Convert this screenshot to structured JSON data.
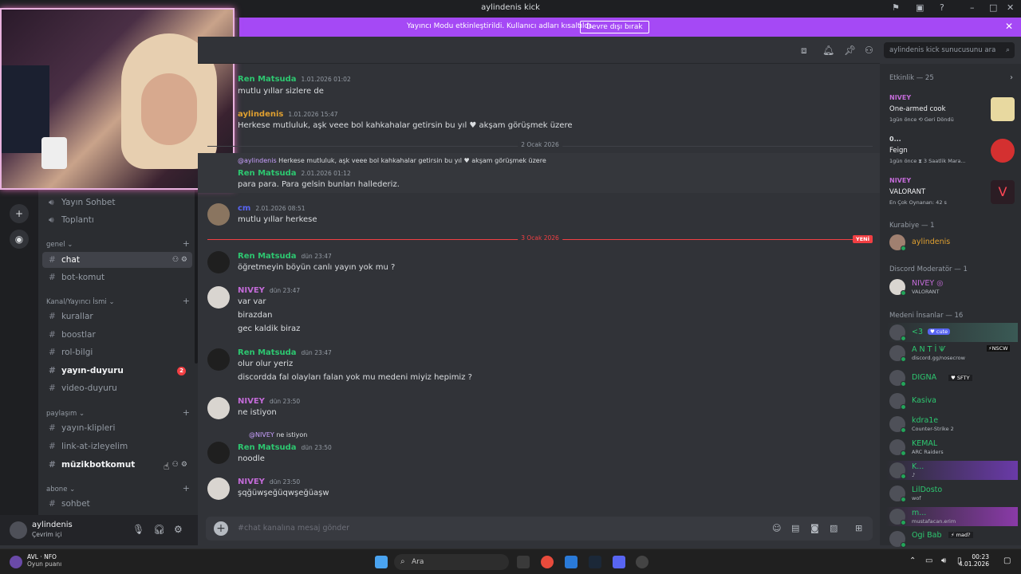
{
  "window": {
    "title": "aylindenis kick"
  },
  "banner": {
    "message": "Yayıncı Modu etkinleştirildi. Kullanıcı adları kısaltıldı.",
    "button": "Devre dışı bırak"
  },
  "channels": {
    "top": [
      {
        "name": "Yayın Sohbet",
        "icon": "speaker-icon"
      },
      {
        "name": "Toplantı",
        "icon": "speaker-icon"
      }
    ],
    "categories": [
      {
        "label": "genel",
        "items": [
          {
            "name": "chat",
            "active": true
          },
          {
            "name": "bot-komut"
          }
        ]
      },
      {
        "label": "Kanal/Yayıncı İsmi",
        "items": [
          {
            "name": "kurallar"
          },
          {
            "name": "boostlar"
          },
          {
            "name": "rol-bilgi"
          },
          {
            "name": "yayın-duyuru",
            "unread": true,
            "badge": "2"
          },
          {
            "name": "video-duyuru"
          }
        ]
      },
      {
        "label": "paylaşım",
        "items": [
          {
            "name": "yayın-klipleri"
          },
          {
            "name": "link-at-izleyelim"
          },
          {
            "name": "müzikbotkomut",
            "unread": true
          }
        ]
      },
      {
        "label": "abone",
        "items": [
          {
            "name": "sohbet"
          }
        ]
      }
    ]
  },
  "user": {
    "name": "aylindenis",
    "status": "Çevrim içi"
  },
  "messages": [
    {
      "author": "Ren Matsuda",
      "color": "#2dc770",
      "time": "1.01.2026 01:02",
      "lines": [
        "mutlu yıllar sizlere de"
      ]
    },
    {
      "author": "aylindenis",
      "color": "#e0a030",
      "time": "1.01.2026 15:47",
      "lines": [
        "Herkese mutluluk, aşk veee bol kahkahalar getirsin bu yıl ♥ akşam görüşmek üzere"
      ]
    },
    {
      "divider": "2 Ocak 2026"
    },
    {
      "reply_user": "@aylindenis",
      "reply_text": "Herkese mutluluk, aşk veee bol kahkahalar getirsin bu yıl ♥ akşam görüşmek üzere",
      "author": "Ren Matsuda",
      "color": "#2dc770",
      "time": "2.01.2026 01:12",
      "lines": [
        "para para. Para gelsin bunları hallederiz."
      ]
    },
    {
      "author": "cm",
      "color": "#5865f2",
      "time": "2.01.2026 08:51",
      "lines": [
        "mutlu yıllar herkese"
      ]
    },
    {
      "divider": "3 Ocak 2026",
      "new": "YENİ"
    },
    {
      "author": "Ren Matsuda",
      "color": "#2dc770",
      "time": "dün 23:47",
      "lines": [
        "öğretmeyin böyün canlı yayın yok mu ?"
      ]
    },
    {
      "author": "NIVEY",
      "color": "#c36bd8",
      "time": "dün 23:47",
      "lines": [
        "var var",
        "birazdan",
        "gec kaldik biraz"
      ]
    },
    {
      "author": "Ren Matsuda",
      "color": "#2dc770",
      "time": "dün 23:47",
      "lines": [
        "olur olur yeriz",
        "discordda fal olayları falan yok mu medeni miyiz hepimiz ?"
      ]
    },
    {
      "author": "NIVEY",
      "color": "#c36bd8",
      "time": "dün 23:50",
      "lines": [
        "ne istiyon"
      ]
    },
    {
      "reply_user": "@NIVEY",
      "reply_text": "ne istiyon",
      "author": "Ren Matsuda",
      "color": "#2dc770",
      "time": "dün 23:50",
      "lines": [
        "noodle"
      ]
    },
    {
      "author": "NIVEY",
      "color": "#c36bd8",
      "time": "dün 23:50",
      "lines": [
        "şqğüwşeğüqwşeğüaşw"
      ]
    }
  ],
  "composer": {
    "placeholder": "#chat kanalına mesaj gönder"
  },
  "search": {
    "placeholder": "aylindenis kick sunucusunu ara"
  },
  "activity": {
    "header": "Etkinlik — 25",
    "items": [
      {
        "user": "NIVEY",
        "title": "One-armed cook",
        "meta": "1gün önce  ⟲ Geri Döndü",
        "art": "#e8d9a0"
      },
      {
        "user": "0...",
        "title": "Feign",
        "meta": "1gün önce  ⧗ 3 Saatlik Mara...",
        "art": "#d43030"
      },
      {
        "user": "NIVEY",
        "title": "VALORANT",
        "meta": "En Çok Oynanan: 42 s",
        "art": "#2b1d24"
      }
    ]
  },
  "member_groups": [
    {
      "label": "Kurabiye — 1",
      "members": [
        {
          "name": "aylindenis",
          "color": "#e0a030"
        }
      ]
    },
    {
      "label": "Discord Moderatör — 1",
      "members": [
        {
          "name": "NIVEY ◎",
          "color": "#c36bd8",
          "sub": "VALORANT"
        }
      ]
    },
    {
      "label": "Medeni İnsanlar — 16",
      "members": [
        {
          "name": "<3",
          "color": "#2dc770",
          "sub": "",
          "tag": "♥ cute"
        },
        {
          "name": "A N T İ Ѱ",
          "color": "#2dc770",
          "sub": "discord.gg/nosecrow",
          "tag": "⚡NSCW"
        },
        {
          "name": "DIGNA",
          "color": "#2dc770",
          "tag": "♥ SFTY"
        },
        {
          "name": "Kasiva",
          "color": "#2dc770"
        },
        {
          "name": "kdra1e",
          "color": "#2dc770",
          "sub": "Counter-Strike 2"
        },
        {
          "name": "KEMAL",
          "color": "#2dc770",
          "sub": "ARC Raiders"
        },
        {
          "name": "K...",
          "color": "#2dc770",
          "sub": "♪"
        },
        {
          "name": "LilDosto",
          "color": "#2dc770",
          "sub": "wof"
        },
        {
          "name": "m...",
          "color": "#2dc770",
          "sub": "mustafacan.erim"
        },
        {
          "name": "Ogi Bab",
          "color": "#2dc770",
          "tag": "⚡ mad?"
        }
      ]
    }
  ],
  "taskbar": {
    "weather": "AVL · NFO",
    "weather_sub": "Oyun puanı",
    "search": "Ara",
    "time": "00:23",
    "date": "4.01.2026"
  }
}
